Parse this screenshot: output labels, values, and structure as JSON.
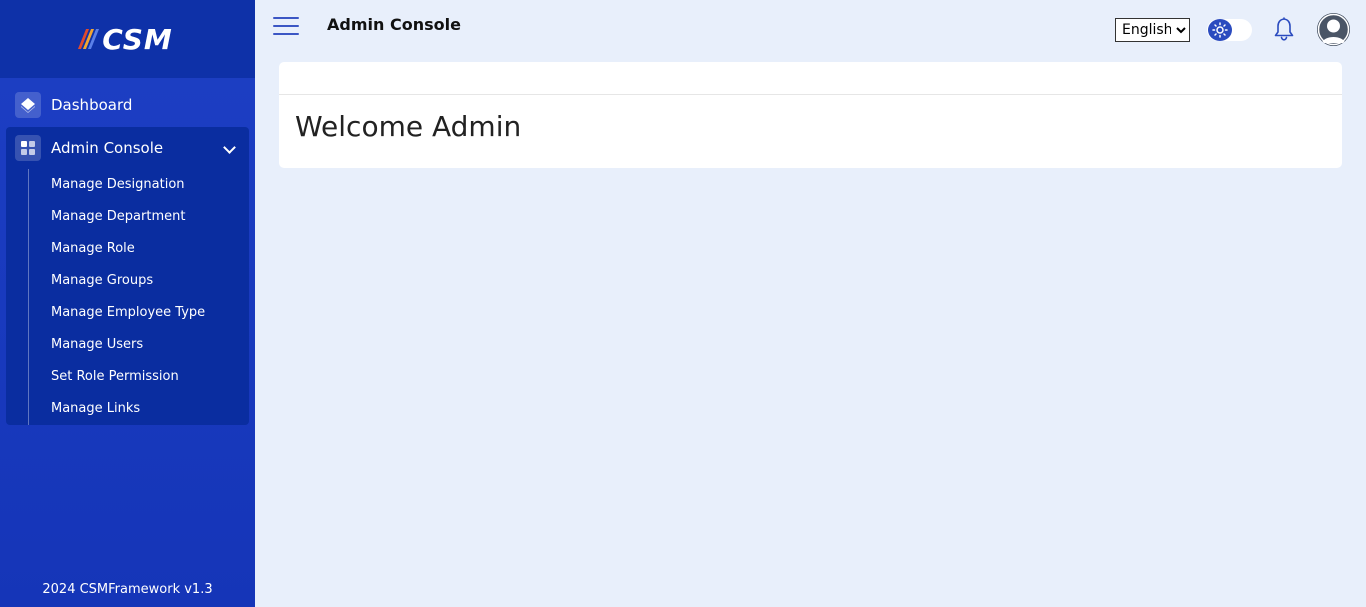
{
  "brand": {
    "logo_text": "CSM",
    "stripe_colors": [
      "#e04a2d",
      "#f2a531",
      "#5a7fe8"
    ]
  },
  "sidebar": {
    "dashboard_label": "Dashboard",
    "admin_label": "Admin Console",
    "items": [
      {
        "label": "Manage Designation"
      },
      {
        "label": "Manage Department"
      },
      {
        "label": "Manage Role"
      },
      {
        "label": "Manage Groups"
      },
      {
        "label": "Manage Employee Type"
      },
      {
        "label": "Manage Users"
      },
      {
        "label": "Set Role Permission"
      },
      {
        "label": "Manage Links"
      }
    ],
    "footer": "2024 CSMFramework v1.3"
  },
  "header": {
    "title": "Admin Console",
    "language": {
      "selected": "English",
      "options": [
        "English"
      ]
    },
    "theme": "light"
  },
  "main": {
    "welcome": "Welcome Admin"
  },
  "colors": {
    "sidebar": "#1535b8",
    "sidebar_header": "#0e31a8",
    "submenu_bg": "#0a2da0",
    "background": "#e8effb",
    "accent": "#2b4bbf"
  }
}
